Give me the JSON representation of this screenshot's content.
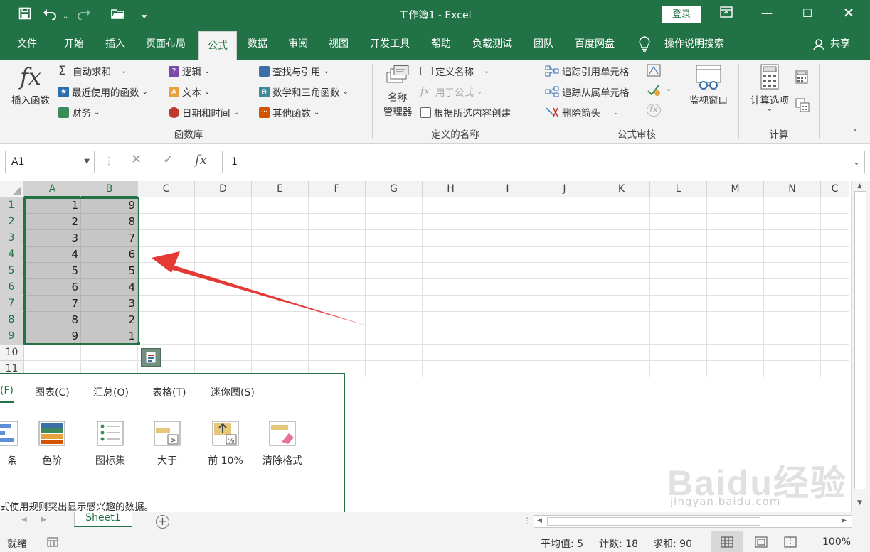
{
  "window": {
    "title": "工作簿1 - Excel",
    "login_label": "登录",
    "accent": "#217346"
  },
  "quick_access": {
    "save_icon": "save-icon",
    "undo_icon": "undo-icon",
    "redo_icon": "redo-icon",
    "open_icon": "open-icon",
    "more_icon": "customize-icon"
  },
  "tabs": [
    {
      "label": "文件"
    },
    {
      "label": "开始"
    },
    {
      "label": "插入"
    },
    {
      "label": "页面布局"
    },
    {
      "label": "公式"
    },
    {
      "label": "数据"
    },
    {
      "label": "审阅"
    },
    {
      "label": "视图"
    },
    {
      "label": "开发工具"
    },
    {
      "label": "帮助"
    },
    {
      "label": "负载测试"
    },
    {
      "label": "团队"
    },
    {
      "label": "百度网盘"
    },
    {
      "label": "操作说明搜索"
    },
    {
      "label": "共享"
    }
  ],
  "ribbon": {
    "fx_big": "fx",
    "insert_function": "插入函数",
    "autosum": "自动求和",
    "recent": "最近使用的函数",
    "financial": "财务",
    "logical": "逻辑",
    "text": "文本",
    "datetime": "日期和时间",
    "lookup": "查找与引用",
    "math": "数学和三角函数",
    "other": "其他函数",
    "group_library": "函数库",
    "name_manager_1": "名称",
    "name_manager_2": "管理器",
    "define_name": "定义名称",
    "use_in_formula": "用于公式",
    "create_from_sel": "根据所选内容创建",
    "group_names": "定义的名称",
    "trace_precedents": "追踪引用单元格",
    "trace_dependents": "追踪从属单元格",
    "remove_arrows": "删除箭头",
    "group_audit": "公式审核",
    "watch_window": "监视窗口",
    "calc_options": "计算选项",
    "group_calc": "计算"
  },
  "formula_bar": {
    "name_box": "A1",
    "fx_label": "fx",
    "value": "1"
  },
  "grid": {
    "columns": [
      "A",
      "B",
      "C",
      "D",
      "E",
      "F",
      "G",
      "H",
      "I",
      "J",
      "K",
      "L",
      "M",
      "N",
      "C"
    ],
    "rows": [
      "1",
      "2",
      "3",
      "4",
      "5",
      "6",
      "7",
      "8",
      "9",
      "10",
      "11"
    ],
    "col_a": [
      "1",
      "2",
      "3",
      "4",
      "5",
      "6",
      "7",
      "8",
      "9"
    ],
    "col_b": [
      "9",
      "8",
      "7",
      "6",
      "5",
      "4",
      "3",
      "2",
      "1"
    ]
  },
  "quick_analysis": {
    "tabs": [
      {
        "label": "(F)"
      },
      {
        "label": "图表(C)"
      },
      {
        "label": "汇总(O)"
      },
      {
        "label": "表格(T)"
      },
      {
        "label": "迷你图(S)"
      }
    ],
    "options": [
      {
        "label": "条"
      },
      {
        "label": "色阶"
      },
      {
        "label": "图标集"
      },
      {
        "label": "大于"
      },
      {
        "label": "前 10%"
      },
      {
        "label": "清除格式"
      }
    ],
    "description": "式使用规则突出显示感兴趣的数据。"
  },
  "sheets": {
    "active": "Sheet1"
  },
  "status": {
    "ready": "就绪",
    "average": "平均值: 5",
    "count": "计数: 18",
    "sum": "求和: 90",
    "zoom": "100%"
  },
  "watermark": {
    "brand": "Baidu经验",
    "url": "jingyan.baidu.com"
  }
}
